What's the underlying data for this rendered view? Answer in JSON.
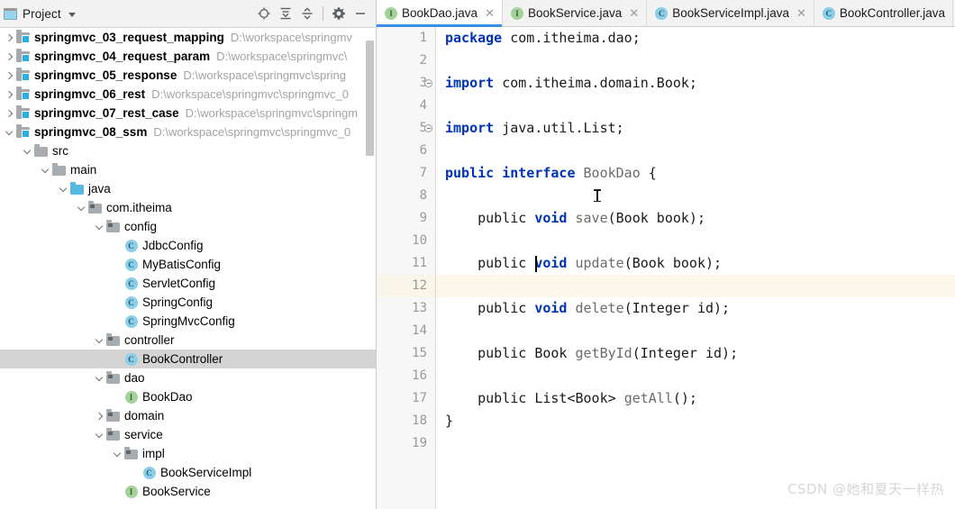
{
  "project_panel": {
    "title": "Project",
    "window_icon": "project-window-icon",
    "dropdown_icon": "chevron-down-icon",
    "toolbar_buttons": [
      {
        "name": "locate-icon",
        "tooltip": "Select Opened File"
      },
      {
        "name": "expand-all-icon",
        "tooltip": "Expand All"
      },
      {
        "name": "collapse-all-icon",
        "tooltip": "Collapse All"
      },
      {
        "name": "gear-icon",
        "tooltip": "Settings"
      },
      {
        "name": "minimize-icon",
        "tooltip": "Hide"
      }
    ],
    "tree": [
      {
        "label": "springmvc_03_request_mapping",
        "path": "D:\\workspace\\springmv",
        "icon": "module-folder",
        "indent": 0,
        "arrow": "right",
        "bold": true
      },
      {
        "label": "springmvc_04_request_param",
        "path": "D:\\workspace\\springmvc\\",
        "icon": "module-folder",
        "indent": 0,
        "arrow": "right",
        "bold": true
      },
      {
        "label": "springmvc_05_response",
        "path": "D:\\workspace\\springmvc\\spring",
        "icon": "module-folder",
        "indent": 0,
        "arrow": "right",
        "bold": true
      },
      {
        "label": "springmvc_06_rest",
        "path": "D:\\workspace\\springmvc\\springmvc_0",
        "icon": "module-folder",
        "indent": 0,
        "arrow": "right",
        "bold": true
      },
      {
        "label": "springmvc_07_rest_case",
        "path": "D:\\workspace\\springmvc\\springm",
        "icon": "module-folder",
        "indent": 0,
        "arrow": "right",
        "bold": true
      },
      {
        "label": "springmvc_08_ssm",
        "path": "D:\\workspace\\springmvc\\springmvc_0",
        "icon": "module-folder",
        "indent": 0,
        "arrow": "down",
        "bold": true
      },
      {
        "label": "src",
        "path": "",
        "icon": "folder",
        "indent": 1,
        "arrow": "down",
        "bold": false
      },
      {
        "label": "main",
        "path": "",
        "icon": "folder",
        "indent": 2,
        "arrow": "down",
        "bold": false
      },
      {
        "label": "java",
        "path": "",
        "icon": "source-folder",
        "indent": 3,
        "arrow": "down",
        "bold": false
      },
      {
        "label": "com.itheima",
        "path": "",
        "icon": "package",
        "indent": 4,
        "arrow": "down",
        "bold": false
      },
      {
        "label": "config",
        "path": "",
        "icon": "package",
        "indent": 5,
        "arrow": "down",
        "bold": false
      },
      {
        "label": "JdbcConfig",
        "path": "",
        "icon": "class",
        "indent": 6,
        "arrow": "none",
        "bold": false
      },
      {
        "label": "MyBatisConfig",
        "path": "",
        "icon": "class",
        "indent": 6,
        "arrow": "none",
        "bold": false
      },
      {
        "label": "ServletConfig",
        "path": "",
        "icon": "class",
        "indent": 6,
        "arrow": "none",
        "bold": false
      },
      {
        "label": "SpringConfig",
        "path": "",
        "icon": "class",
        "indent": 6,
        "arrow": "none",
        "bold": false
      },
      {
        "label": "SpringMvcConfig",
        "path": "",
        "icon": "class",
        "indent": 6,
        "arrow": "none",
        "bold": false
      },
      {
        "label": "controller",
        "path": "",
        "icon": "package",
        "indent": 5,
        "arrow": "down",
        "bold": false
      },
      {
        "label": "BookController",
        "path": "",
        "icon": "class",
        "indent": 6,
        "arrow": "none",
        "bold": false,
        "selected": true
      },
      {
        "label": "dao",
        "path": "",
        "icon": "package",
        "indent": 5,
        "arrow": "down",
        "bold": false
      },
      {
        "label": "BookDao",
        "path": "",
        "icon": "interface",
        "indent": 6,
        "arrow": "none",
        "bold": false
      },
      {
        "label": "domain",
        "path": "",
        "icon": "package",
        "indent": 5,
        "arrow": "right",
        "bold": false
      },
      {
        "label": "service",
        "path": "",
        "icon": "package",
        "indent": 5,
        "arrow": "down",
        "bold": false
      },
      {
        "label": "impl",
        "path": "",
        "icon": "package",
        "indent": 6,
        "arrow": "down",
        "bold": false
      },
      {
        "label": "BookServiceImpl",
        "path": "",
        "icon": "class",
        "indent": 7,
        "arrow": "none",
        "bold": false
      },
      {
        "label": "BookService",
        "path": "",
        "icon": "interface",
        "indent": 6,
        "arrow": "none",
        "bold": false
      }
    ]
  },
  "editor": {
    "tabs": [
      {
        "label": "BookDao.java",
        "icon": "interface",
        "active": true,
        "close_icon": "close-icon"
      },
      {
        "label": "BookService.java",
        "icon": "interface",
        "active": false,
        "close_icon": "close-icon"
      },
      {
        "label": "BookServiceImpl.java",
        "icon": "class",
        "active": false,
        "close_icon": "close-icon"
      },
      {
        "label": "BookController.java",
        "icon": "class",
        "active": false,
        "close_icon": ""
      }
    ],
    "current_line": 12,
    "line_numbers": [
      1,
      2,
      3,
      4,
      5,
      6,
      7,
      8,
      9,
      10,
      11,
      12,
      13,
      14,
      15,
      16,
      17,
      18,
      19
    ],
    "code_lines": [
      {
        "n": 1,
        "tokens": [
          {
            "t": "package ",
            "c": "kw"
          },
          {
            "t": "com.itheima.dao;",
            "c": "plain"
          }
        ],
        "fold": false
      },
      {
        "n": 2,
        "tokens": [],
        "fold": false
      },
      {
        "n": 3,
        "tokens": [
          {
            "t": "import ",
            "c": "kw"
          },
          {
            "t": "com.itheima.domain.Book;",
            "c": "plain"
          }
        ],
        "fold": true
      },
      {
        "n": 4,
        "tokens": [],
        "fold": false
      },
      {
        "n": 5,
        "tokens": [
          {
            "t": "import ",
            "c": "kw"
          },
          {
            "t": "java.util.List;",
            "c": "plain"
          }
        ],
        "fold": true
      },
      {
        "n": 6,
        "tokens": [],
        "fold": false
      },
      {
        "n": 7,
        "tokens": [
          {
            "t": "public interface ",
            "c": "kw"
          },
          {
            "t": "BookDao ",
            "c": "type"
          },
          {
            "t": "{",
            "c": "plain"
          }
        ],
        "fold": false
      },
      {
        "n": 8,
        "tokens": [],
        "fold": false
      },
      {
        "n": 9,
        "tokens": [
          {
            "t": "    public ",
            "c": "plain"
          },
          {
            "t": "void ",
            "c": "kw"
          },
          {
            "t": "save",
            "c": "type"
          },
          {
            "t": "(Book book);",
            "c": "plain"
          }
        ],
        "fold": false
      },
      {
        "n": 10,
        "tokens": [],
        "fold": false
      },
      {
        "n": 11,
        "tokens": [
          {
            "t": "    public ",
            "c": "plain"
          },
          {
            "t": "void ",
            "c": "kw"
          },
          {
            "t": "update",
            "c": "type"
          },
          {
            "t": "(Book book);",
            "c": "plain"
          }
        ],
        "fold": false
      },
      {
        "n": 12,
        "tokens": [
          {
            "t": "    ",
            "c": "plain"
          }
        ],
        "fold": false
      },
      {
        "n": 13,
        "tokens": [
          {
            "t": "    public ",
            "c": "plain"
          },
          {
            "t": "void ",
            "c": "kw"
          },
          {
            "t": "delete",
            "c": "type"
          },
          {
            "t": "(Integer id);",
            "c": "plain"
          }
        ],
        "fold": false
      },
      {
        "n": 14,
        "tokens": [],
        "fold": false
      },
      {
        "n": 15,
        "tokens": [
          {
            "t": "    public Book ",
            "c": "plain"
          },
          {
            "t": "getById",
            "c": "type"
          },
          {
            "t": "(Integer id);",
            "c": "plain"
          }
        ],
        "fold": false
      },
      {
        "n": 16,
        "tokens": [],
        "fold": false
      },
      {
        "n": 17,
        "tokens": [
          {
            "t": "    public List<Book> ",
            "c": "plain"
          },
          {
            "t": "getAll",
            "c": "type"
          },
          {
            "t": "();",
            "c": "plain"
          }
        ],
        "fold": false
      },
      {
        "n": 18,
        "tokens": [
          {
            "t": "}",
            "c": "plain"
          }
        ],
        "fold": false
      },
      {
        "n": 19,
        "tokens": [],
        "fold": false
      }
    ]
  },
  "watermark": "CSDN @她和夏天一样热",
  "colors": {
    "accent": "#3b8ee0",
    "keyword": "#0033b3",
    "selection": "#d4d4d4",
    "current_line": "#fcf7e9",
    "module_chip": "#2ab0e0",
    "interface_icon": "#a5d29a",
    "class_icon": "#8ccde8"
  }
}
